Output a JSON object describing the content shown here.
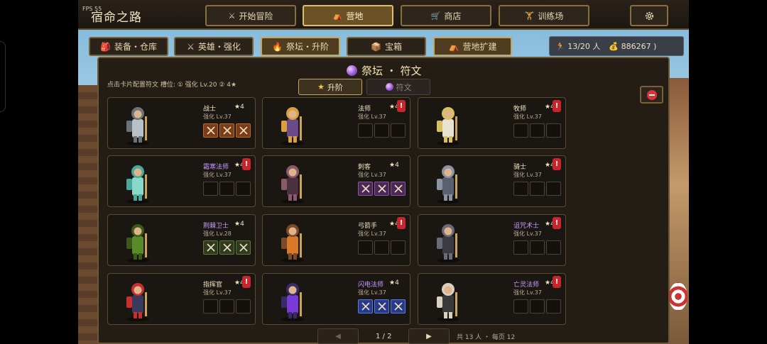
{
  "fps": "FPS 55",
  "game_title": "宿命之路",
  "top_nav": [
    {
      "label": "开始冒险",
      "icon": "⚔"
    },
    {
      "label": "营地",
      "icon": "⛺"
    },
    {
      "label": "商店",
      "icon": "🛒"
    },
    {
      "label": "训练场",
      "icon": "🏋"
    }
  ],
  "sub_tabs": [
    {
      "label": "装备・仓库",
      "icon": "🎒"
    },
    {
      "label": "英雄・强化",
      "icon": "⚔"
    },
    {
      "label": "祭坛・升阶",
      "icon": "🔥"
    },
    {
      "label": "宝箱",
      "icon": "📦"
    },
    {
      "label": "营地扩建",
      "icon": "⛺"
    }
  ],
  "resources": {
    "heroes": "13/20 人",
    "gold": "886267 )"
  },
  "panel": {
    "title": "祭坛 ・ 符文",
    "hint": "点击卡片配置符文   槽位: ① 强化 Lv.20   ② 4★",
    "tab_upgrade": "升阶",
    "tab_rune": "符文"
  },
  "heroes": [
    {
      "name": "战士",
      "star": "★4",
      "level": "强化 Lv.37",
      "rarity": "normal",
      "alert": false,
      "slot": "orange",
      "filled": 3
    },
    {
      "name": "法师",
      "star": "★4",
      "level": "强化 Lv.37",
      "rarity": "normal",
      "alert": true,
      "slot": "",
      "filled": 0
    },
    {
      "name": "牧师",
      "star": "★4",
      "level": "强化 Lv.37",
      "rarity": "normal",
      "alert": true,
      "slot": "",
      "filled": 0
    },
    {
      "name": "霜寒法师",
      "star": "★4",
      "level": "强化 Lv.37",
      "rarity": "epic",
      "alert": true,
      "slot": "",
      "filled": 0
    },
    {
      "name": "刺客",
      "star": "★4",
      "level": "强化 Lv.37",
      "rarity": "normal",
      "alert": false,
      "slot": "purple",
      "filled": 3
    },
    {
      "name": "骑士",
      "star": "★4",
      "level": "强化 Lv.37",
      "rarity": "normal",
      "alert": true,
      "slot": "",
      "filled": 0
    },
    {
      "name": "荆棘卫士",
      "star": "★4",
      "level": "强化 Lv.28",
      "rarity": "epic",
      "alert": false,
      "slot": "green",
      "filled": 3
    },
    {
      "name": "弓箭手",
      "star": "★4",
      "level": "强化 Lv.37",
      "rarity": "normal",
      "alert": true,
      "slot": "",
      "filled": 0
    },
    {
      "name": "诅咒术士",
      "star": "★4",
      "level": "强化 Lv.37",
      "rarity": "epic",
      "alert": true,
      "slot": "",
      "filled": 0
    },
    {
      "name": "指挥官",
      "star": "★4",
      "level": "强化 Lv.37",
      "rarity": "normal",
      "alert": true,
      "slot": "",
      "filled": 0
    },
    {
      "name": "闪电法师",
      "star": "★4",
      "level": "强化 Lv.37",
      "rarity": "epic",
      "alert": false,
      "slot": "blue",
      "filled": 3
    },
    {
      "name": "亡灵法师",
      "star": "★4",
      "level": "强化 Lv.37",
      "rarity": "epic",
      "alert": true,
      "slot": "",
      "filled": 0
    }
  ],
  "pager": {
    "prev": "◀",
    "next": "▶",
    "page": "1 / 2",
    "meta": "共 13 人 ・ 每页 12"
  },
  "colors": {
    "accent": "#e0bd6a",
    "panel": "#231d16",
    "alert": "#c8262c",
    "epic_name": "#c79cff"
  }
}
